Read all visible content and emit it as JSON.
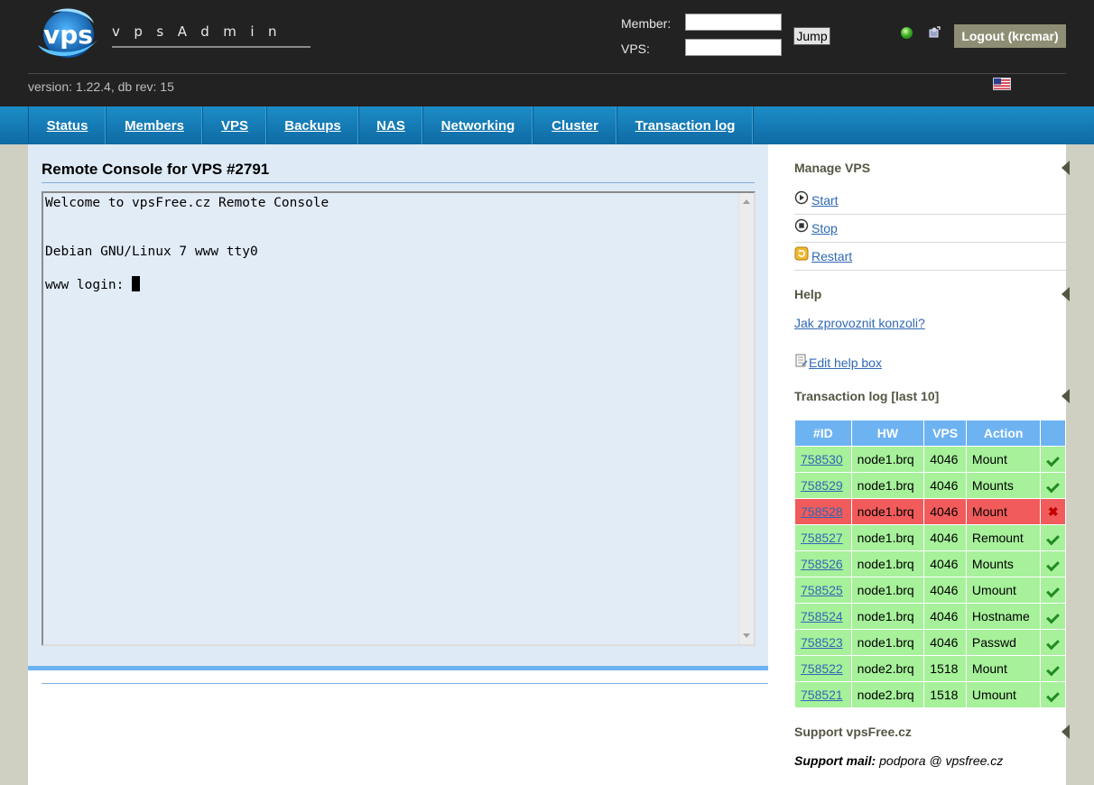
{
  "header": {
    "logo_text": "vps",
    "brand": "vpsAdmin",
    "member_label": "Member:",
    "vps_label": "VPS:",
    "member_value": "",
    "vps_value": "",
    "jump_label": "Jump",
    "logout_label": "Logout (krcmar)",
    "version": "version: 1.22.4, db rev: 15"
  },
  "nav": {
    "items": [
      {
        "label": "Status"
      },
      {
        "label": "Members"
      },
      {
        "label": "VPS"
      },
      {
        "label": "Backups"
      },
      {
        "label": "NAS"
      },
      {
        "label": "Networking"
      },
      {
        "label": "Cluster"
      },
      {
        "label": "Transaction log"
      }
    ]
  },
  "main": {
    "title": "Remote Console for VPS #2791",
    "console": {
      "line1": "Welcome to vpsFree.cz Remote Console",
      "line2": "Debian GNU/Linux 7 www tty0",
      "line3": "www login: "
    }
  },
  "sidebar": {
    "manage_title": "Manage VPS",
    "actions": [
      {
        "label": "Start",
        "icon": "play-icon"
      },
      {
        "label": "Stop",
        "icon": "stop-icon"
      },
      {
        "label": "Restart",
        "icon": "restart-icon"
      }
    ],
    "help_title": "Help",
    "help_link": "Jak zprovoznit konzoli?",
    "edit_help": "Edit help box",
    "translog_title": "Transaction log [last 10]",
    "translog_headers": [
      "#ID",
      "HW",
      "VPS",
      "Action",
      ""
    ],
    "translog_rows": [
      {
        "id": "758530",
        "hw": "node1.brq",
        "vps": "4046",
        "action": "Mount",
        "ok": true
      },
      {
        "id": "758529",
        "hw": "node1.brq",
        "vps": "4046",
        "action": "Mounts",
        "ok": true
      },
      {
        "id": "758528",
        "hw": "node1.brq",
        "vps": "4046",
        "action": "Mount",
        "ok": false
      },
      {
        "id": "758527",
        "hw": "node1.brq",
        "vps": "4046",
        "action": "Remount",
        "ok": true
      },
      {
        "id": "758526",
        "hw": "node1.brq",
        "vps": "4046",
        "action": "Mounts",
        "ok": true
      },
      {
        "id": "758525",
        "hw": "node1.brq",
        "vps": "4046",
        "action": "Umount",
        "ok": true
      },
      {
        "id": "758524",
        "hw": "node1.brq",
        "vps": "4046",
        "action": "Hostname",
        "ok": true
      },
      {
        "id": "758523",
        "hw": "node1.brq",
        "vps": "4046",
        "action": "Passwd",
        "ok": true
      },
      {
        "id": "758522",
        "hw": "node2.brq",
        "vps": "1518",
        "action": "Mount",
        "ok": true
      },
      {
        "id": "758521",
        "hw": "node2.brq",
        "vps": "1518",
        "action": "Umount",
        "ok": true
      }
    ],
    "support_title": "Support vpsFree.cz",
    "support_mail_label": "Support mail:",
    "support_mail_value": "podpora @ vpsfree.cz"
  },
  "colors": {
    "header_bg": "#222222",
    "nav_bg": "#1478b5",
    "accent_blue": "#6db3f2",
    "ok_row": "#a6f19a",
    "error_row": "#f25b5b",
    "link": "#2f68b5"
  }
}
